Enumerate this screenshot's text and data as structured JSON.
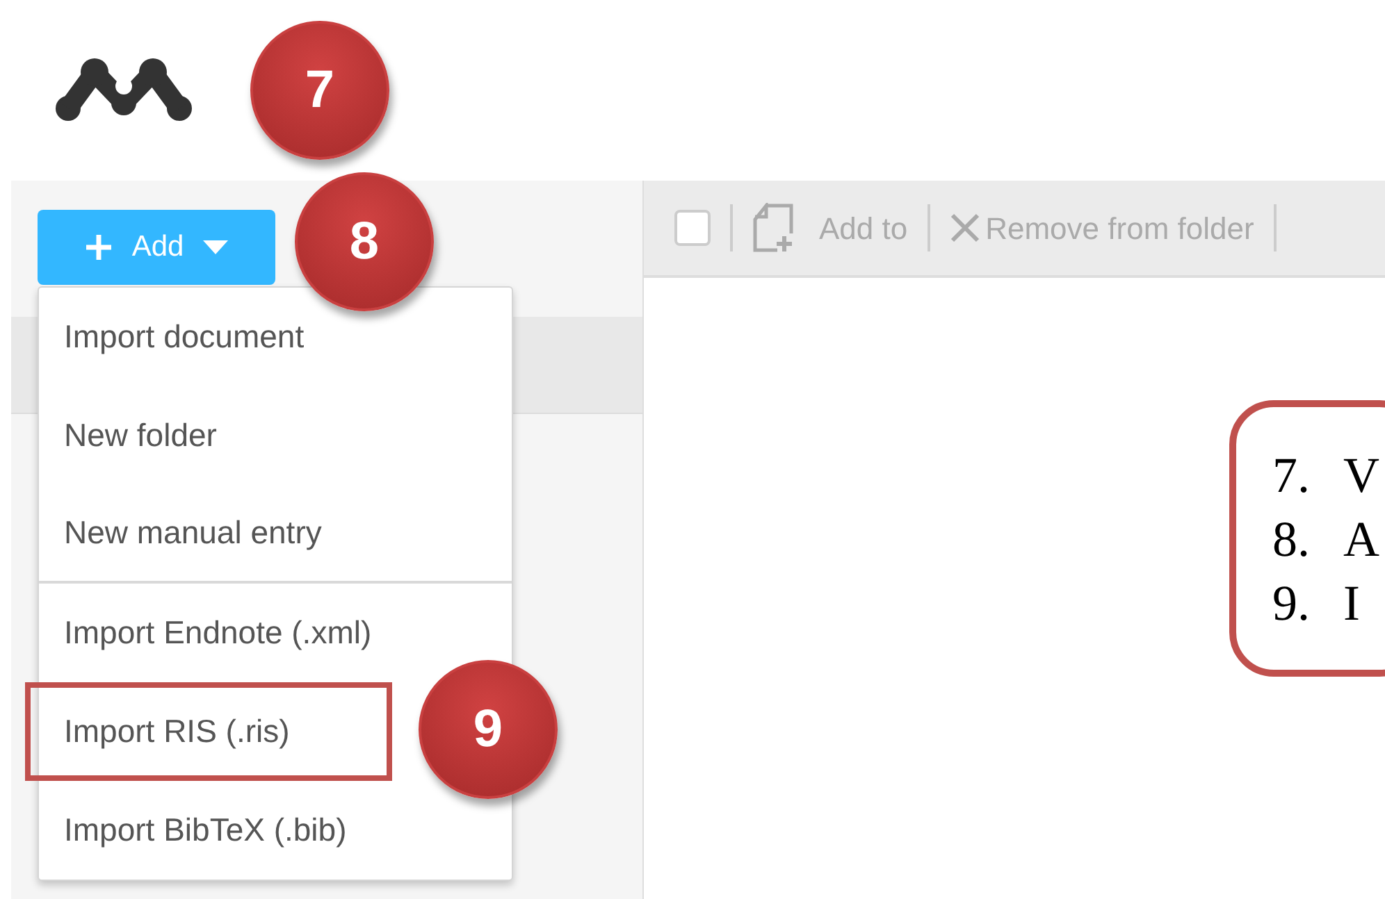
{
  "step_badges": [
    {
      "label": "7"
    },
    {
      "label": "8"
    },
    {
      "label": "9"
    }
  ],
  "add_button": {
    "label": "Add"
  },
  "add_menu": [
    {
      "label": "Import document",
      "divider_after": false,
      "highlighted": false
    },
    {
      "label": "New folder",
      "divider_after": false,
      "highlighted": false
    },
    {
      "label": "New manual entry",
      "divider_after": true,
      "highlighted": false
    },
    {
      "label": "Import Endnote (.xml)",
      "divider_after": false,
      "highlighted": false
    },
    {
      "label": "Import RIS (.ris)",
      "divider_after": false,
      "highlighted": true
    },
    {
      "label": "Import BibTeX (.bib)",
      "divider_after": false,
      "highlighted": false
    }
  ],
  "toolbar": {
    "select_all_checked": false,
    "add_to": "Add to",
    "remove": "Remove from folder"
  },
  "callout": [
    {
      "number": "7.",
      "text": "V"
    },
    {
      "number": "8.",
      "text": "A"
    },
    {
      "number": "9.",
      "text": "I"
    }
  ]
}
